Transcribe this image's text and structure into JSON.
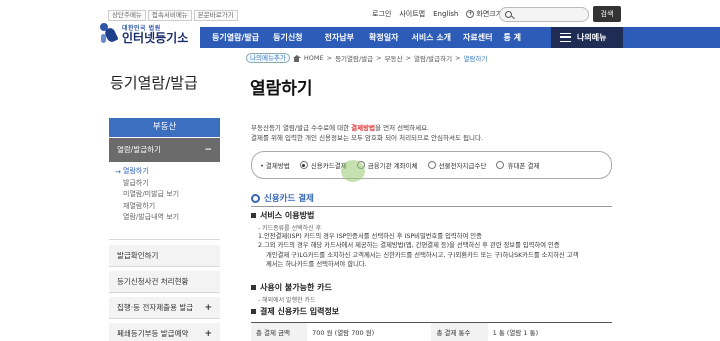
{
  "topbar": {
    "quick_links": [
      "상단주메뉴",
      "접속서비메뉴",
      "본문바로가기"
    ],
    "login": "로그인",
    "sitemap": "사이트맵",
    "english": "English",
    "zoom_label": "화면크기",
    "zoom_in": "+",
    "zoom_out": "−",
    "search_button": "검색"
  },
  "logo": {
    "sub": "대한민국 법원",
    "main": "인터넷등기소"
  },
  "nav": {
    "items": [
      "등기열람/발급",
      "등기신청",
      "전자납부",
      "확정일자",
      "서비스 소개",
      "자료센터",
      "통 계"
    ],
    "my_menu": "나의메뉴"
  },
  "breadcrumb": {
    "add_label": "나의메뉴추가",
    "path": [
      "HOME",
      "등기열람/발급",
      "부동산",
      "열람/발급하기"
    ],
    "current": "열람하기"
  },
  "sidebar": {
    "title": "등기열람/발급",
    "section": "부동산",
    "active_item": "열람/발급하기",
    "active_sign": "−",
    "submenu": [
      "열람하기",
      "발급하기",
      "미열람/미발급 보기",
      "재열람하기",
      "열람/발급내역 보기"
    ],
    "items": [
      {
        "label": "발급확인하기",
        "sign": ""
      },
      {
        "label": "등기신청사건 처리현황",
        "sign": ""
      },
      {
        "label": "집행·등 전자제출용 발급",
        "sign": "+"
      },
      {
        "label": "폐쇄등기부등 발급예약",
        "sign": "+"
      }
    ]
  },
  "content": {
    "page_title": "열람하기",
    "notice_line1_pre": "부동산등기 열람/발급 수수료에 대한 ",
    "notice_line1_red": "결제방법",
    "notice_line1_post": "을 먼저 선택하세요.",
    "notice_line2": "결제를 위해 입력한 개인 신용정보는 모두 암호화 되어 처리되므로 안심하셔도 됩니다.",
    "payment": {
      "label": "• 결제방법",
      "options": [
        "신용카드결제",
        "금융기관 계좌이체",
        "선불전자지급수단",
        "휴대폰 결제"
      ],
      "selected_index": 0
    },
    "section_title": "신용카드 결제",
    "usage": {
      "title": "서비스 이용방법",
      "note": "- 카드종류를 선택하신 후",
      "lines": [
        "1.안전결제(ISP) 카드의 경우 ISP인증서를 선택하신 후 ISP비밀번호를 입력하여 인증",
        "2.그외 카드의 경우 해당 카드사에서 제공하는 결제방법(앱, 간편결제 등)을 선택하신 후 관련 정보를 입력하여 인증",
        "개인결제 구)LG카드를 소지하신 고객께서는 신한카드를 선택하시고, 구)외환카드 또는 구)하나SK카드를 소지하신 고객",
        "께서는 하나카드를 선택하셔야 합니다."
      ]
    },
    "unavailable": {
      "title": "사용이 불가능한 카드",
      "note": "- 해외에서 발행한 카드"
    },
    "card_info_title": "결제 신용카드 입력정보",
    "table": {
      "row1": [
        "총 결제 금액",
        "700 원 (열람 700 원)",
        "총 결제 통수",
        "1 통 (열람 1 통)"
      ]
    }
  }
}
